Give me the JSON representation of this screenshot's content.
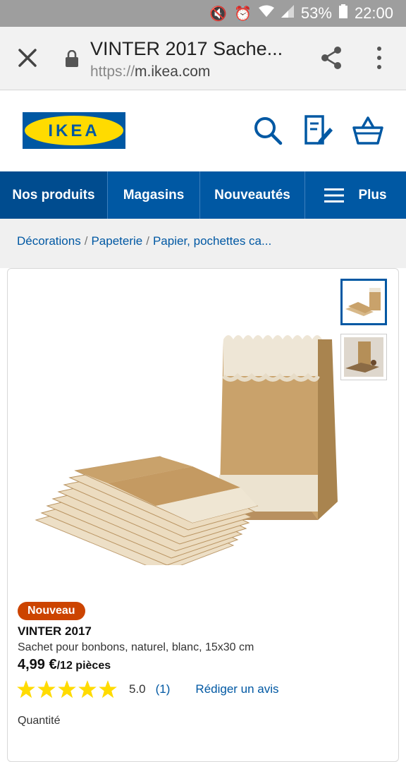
{
  "status_bar": {
    "battery": "53%",
    "time": "22:00",
    "icons": [
      "mute-icon",
      "alarm-icon",
      "wifi-icon",
      "signal-icon",
      "battery-icon"
    ]
  },
  "browser": {
    "page_title": "VINTER 2017 Sache...",
    "url_protocol": "https://",
    "url_host": "m.ikea.com"
  },
  "header": {
    "logo_text": "IKEA",
    "brand_colors": {
      "blue": "#0058a3",
      "yellow": "#ffdb00"
    }
  },
  "nav": {
    "items": [
      "Nos produits",
      "Magasins",
      "Nouveautés",
      "Plus"
    ]
  },
  "breadcrumbs": [
    "Décorations",
    "Papeterie",
    "Papier, pochettes ca..."
  ],
  "product": {
    "badge": "Nouveau",
    "name": "VINTER 2017",
    "description": "Sachet pour bonbons, naturel, blanc, 15x30 cm",
    "price": "4,99 €",
    "price_unit": "/12 pièces",
    "rating_value": 5,
    "rating_text": "5.0",
    "review_count": "(1)",
    "write_review": "Rédiger un avis",
    "quantity_label": "Quantité"
  },
  "colors": {
    "accent": "#0058a3",
    "badge": "#cc4400",
    "star": "#ffdb00"
  }
}
